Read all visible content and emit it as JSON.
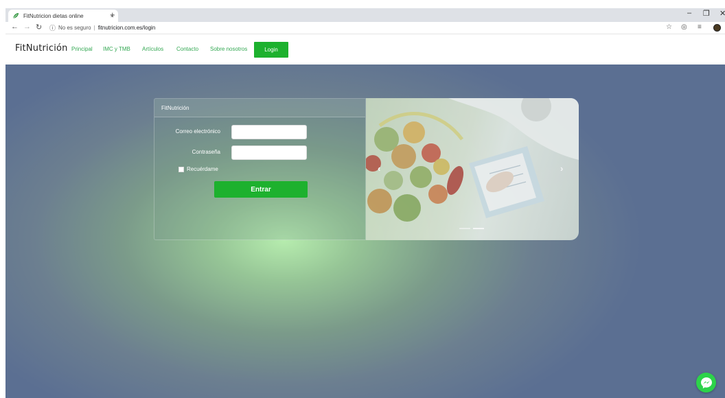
{
  "browser": {
    "tab_title": "FitNutricion dietas online",
    "tab_close": "×",
    "new_tab": "+",
    "not_secure": "No es seguro",
    "separator": "|",
    "url": "fitnutricion.com.es/login"
  },
  "site": {
    "brand": "FitNutrición",
    "nav": [
      "Principal",
      "IMC y TMB",
      "Artículos",
      "Contacto",
      "Sobre nosotros"
    ],
    "login_label": "Login"
  },
  "login_card": {
    "header": "FitNutrición",
    "email_label": "Correo electrónico",
    "password_label": "Contraseña",
    "remember_label": "Recuérdame",
    "submit_label": "Entrar",
    "email_value": "",
    "password_value": ""
  },
  "carousel": {
    "prev_icon": "‹",
    "next_icon": "›",
    "slide_count": 2,
    "active_slide": 2
  },
  "colors": {
    "accent": "#1db12e",
    "link": "#34a853",
    "messenger": "#2dd34a"
  },
  "icons": {
    "messenger": "messenger-icon",
    "favicon": "leaf-icon"
  }
}
